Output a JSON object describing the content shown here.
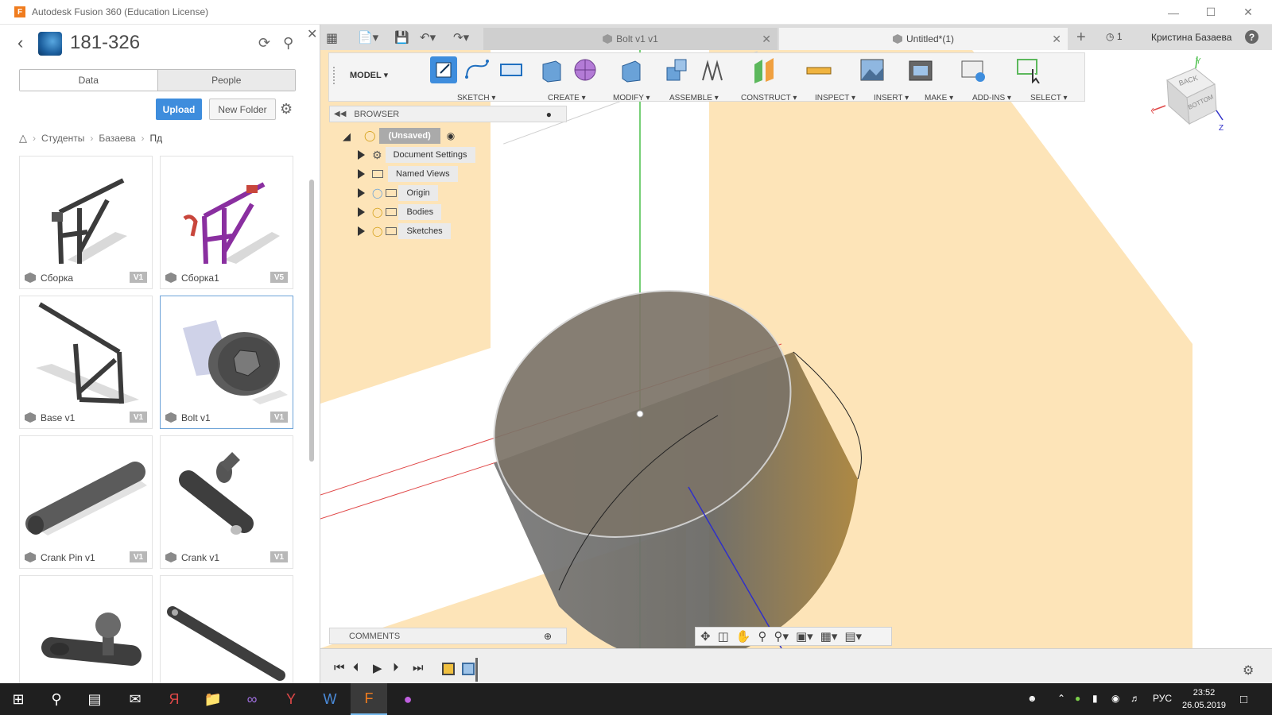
{
  "window": {
    "title": "Autodesk Fusion 360 (Education License)"
  },
  "data_panel": {
    "project_name": "181-326",
    "tabs": [
      "Data",
      "People"
    ],
    "upload_label": "Upload",
    "new_folder_label": "New Folder",
    "breadcrumb": [
      "Студенты",
      "Базаева",
      "Пд"
    ],
    "items": [
      {
        "name": "Сборка",
        "version": "V1"
      },
      {
        "name": "Сборка1",
        "version": "V5"
      },
      {
        "name": "Base v1",
        "version": "V1"
      },
      {
        "name": "Bolt v1",
        "version": "V1"
      },
      {
        "name": "Crank Pin v1",
        "version": "V1"
      },
      {
        "name": "Crank v1",
        "version": "V1"
      }
    ]
  },
  "doc_tabs": [
    {
      "label": "Bolt v1 v1",
      "active": false
    },
    {
      "label": "Untitled*(1)",
      "active": true
    }
  ],
  "header_right": {
    "job_count": "1",
    "user": "Кристина Базаева"
  },
  "toolbar": {
    "workspace": "MODEL",
    "groups": [
      "SKETCH",
      "CREATE",
      "MODIFY",
      "ASSEMBLE",
      "CONSTRUCT",
      "INSPECT",
      "INSERT",
      "MAKE",
      "ADD-INS",
      "SELECT"
    ]
  },
  "browser": {
    "title": "BROWSER",
    "root": "(Unsaved)",
    "nodes": [
      "Document Settings",
      "Named Views",
      "Origin",
      "Bodies",
      "Sketches"
    ]
  },
  "comments": {
    "title": "COMMENTS"
  },
  "viewcube": {
    "top": "BACK",
    "side": "BOTTOM",
    "x_axis": "X",
    "y_axis": "Y",
    "z_axis": "Z"
  },
  "taskbar": {
    "lang": "РУС",
    "time": "23:52",
    "date": "26.05.2019"
  },
  "colors": {
    "accent": "#3e8ddd",
    "plane": "#fde3b4",
    "body": "#7d7466"
  }
}
